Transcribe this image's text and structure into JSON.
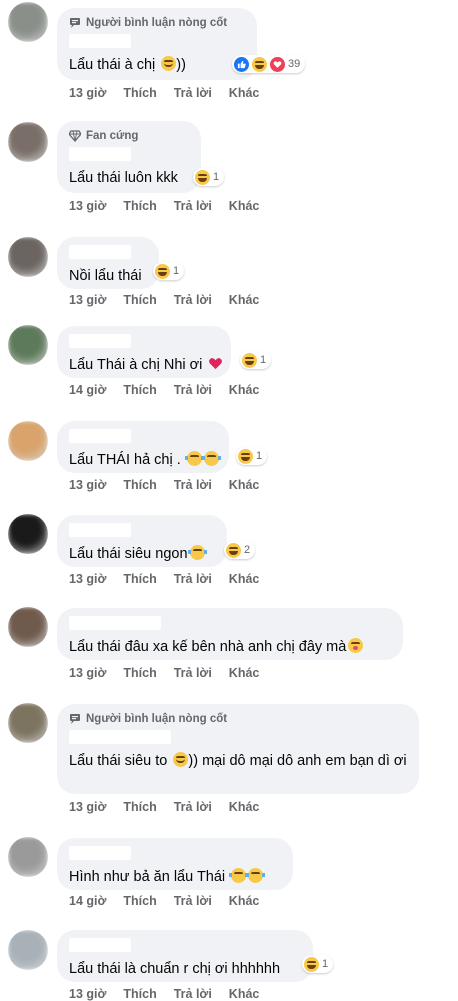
{
  "comments": [
    {
      "badge": "Người bình luận nòng cốt",
      "badge_icon": "speech-bubble-icon",
      "text": "Lẩu thái à chị ",
      "trail": "))",
      "emoji": [
        "smile"
      ],
      "reaction_types": [
        "like",
        "laugh",
        "love"
      ],
      "reaction_count": "39",
      "time": "13 giờ",
      "avatar_color": "#8a8f8a"
    },
    {
      "badge": "Fan cứng",
      "badge_icon": "diamond-icon",
      "text": "Lẩu thái luôn kkk",
      "trail": "",
      "emoji": [],
      "reaction_types": [
        "laugh"
      ],
      "reaction_count": "1",
      "time": "13 giờ",
      "avatar_color": "#7a6f68"
    },
    {
      "badge": "",
      "text": "Nồi lẩu thái",
      "trail": "",
      "emoji": [],
      "reaction_types": [
        "laugh"
      ],
      "reaction_count": "1",
      "time": "13 giờ",
      "avatar_color": "#6b6461"
    },
    {
      "badge": "",
      "text": "Lẩu Thái à chị Nhi ơi ",
      "trail": "",
      "emoji": [
        "heart"
      ],
      "reaction_types": [
        "laugh"
      ],
      "reaction_count": "1",
      "time": "14 giờ",
      "avatar_color": "#5d7a5a"
    },
    {
      "badge": "",
      "text": "Lẩu THÁI hả chị . ",
      "trail": "",
      "emoji": [
        "cry-laugh",
        "cry-laugh"
      ],
      "reaction_types": [
        "laugh"
      ],
      "reaction_count": "1",
      "time": "13 giờ",
      "avatar_color": "#d9a36b"
    },
    {
      "badge": "",
      "text": "Lẩu thái siêu ngon",
      "trail": "",
      "emoji": [
        "cry-laugh"
      ],
      "reaction_types": [
        "laugh"
      ],
      "reaction_count": "2",
      "time": "13 giờ",
      "avatar_color": "#1a1a1a"
    },
    {
      "badge": "",
      "text": "Lẩu thái đâu xa kế bên nhà anh chị đây mà",
      "trail": "",
      "emoji": [
        "kiss"
      ],
      "reaction_types": [],
      "reaction_count": "",
      "time": "13 giờ",
      "avatar_color": "#6f5a4c"
    },
    {
      "badge": "Người bình luận nòng cốt",
      "badge_icon": "speech-bubble-icon",
      "text": "Lẩu thái siêu to ",
      "trail": ")) mại dô mại dô anh em bạn dì ơi",
      "emoji": [
        "smile"
      ],
      "reaction_types": [],
      "reaction_count": "",
      "time": "13 giờ",
      "avatar_color": "#7d7460"
    },
    {
      "badge": "",
      "text": "Hình như bả ăn lẩu Thái ",
      "trail": "",
      "emoji": [
        "cry-laugh",
        "cry-laugh"
      ],
      "reaction_types": [],
      "reaction_count": "",
      "time": "14 giờ",
      "avatar_color": "#9a9a9a"
    },
    {
      "badge": "",
      "text": "Lẩu thái là chuẩn r chị ơi hhhhhh",
      "trail": "",
      "emoji": [],
      "reaction_types": [
        "laugh"
      ],
      "reaction_count": "1",
      "time": "13 giờ",
      "avatar_color": "#a8b0b8"
    }
  ],
  "actions": {
    "like": "Thích",
    "reply": "Trả lời",
    "more": "Khác"
  }
}
